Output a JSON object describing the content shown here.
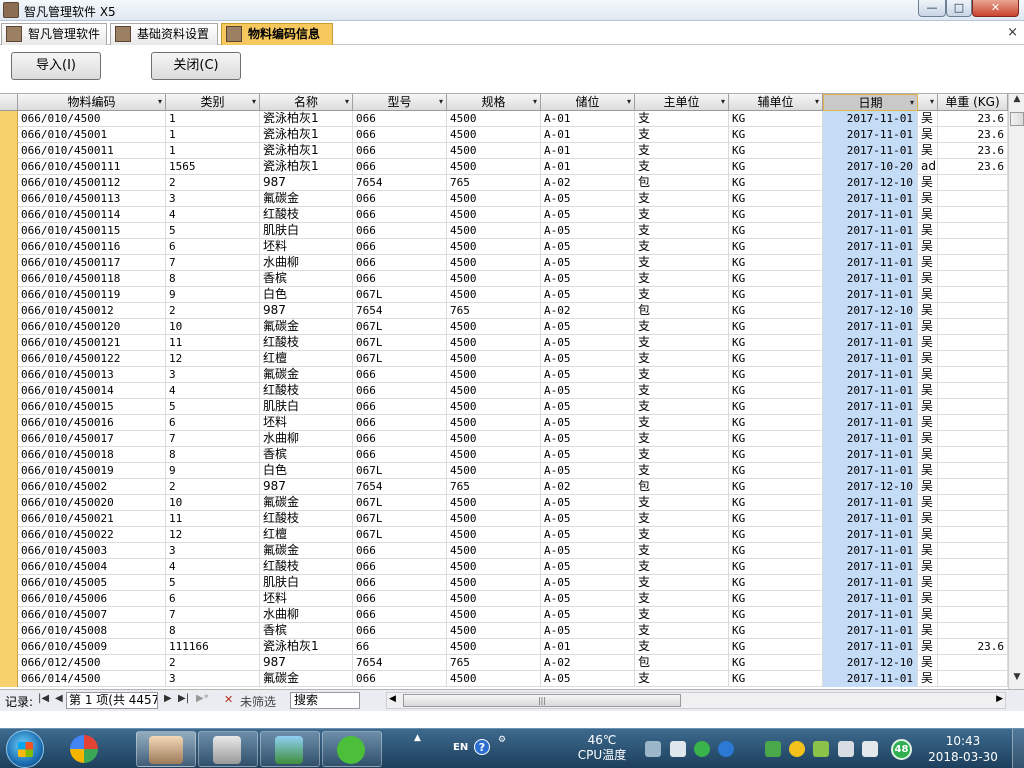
{
  "window": {
    "title": "智凡管理软件 X5",
    "minimize": "—",
    "maximize": "□",
    "close": "✕"
  },
  "tabs": [
    {
      "label": "智凡管理软件",
      "active": false
    },
    {
      "label": "基础资料设置",
      "active": false
    },
    {
      "label": "物料编码信息",
      "active": true
    }
  ],
  "tab_close": "×",
  "toolbar": {
    "import_label": "导入(I)",
    "close_label": "关闭(C)"
  },
  "grid": {
    "columns": [
      {
        "key": "code",
        "label": "物料编码"
      },
      {
        "key": "category",
        "label": "类别"
      },
      {
        "key": "name",
        "label": "名称"
      },
      {
        "key": "model",
        "label": "型号"
      },
      {
        "key": "spec",
        "label": "规格"
      },
      {
        "key": "location",
        "label": "储位"
      },
      {
        "key": "main_unit",
        "label": "主单位"
      },
      {
        "key": "sub_unit",
        "label": "辅单位"
      },
      {
        "key": "date",
        "label": "日期"
      },
      {
        "key": "creator",
        "label": ""
      },
      {
        "key": "unit_weight",
        "label": "单重 (KG)"
      }
    ],
    "rows": [
      [
        "066/010/4500",
        "1",
        "瓷泳柏灰1",
        "066",
        "4500",
        "A-01",
        "支",
        "KG",
        "2017-11-01",
        "吴",
        "23.6"
      ],
      [
        "066/010/45001",
        "1",
        "瓷泳柏灰1",
        "066",
        "4500",
        "A-01",
        "支",
        "KG",
        "2017-11-01",
        "吴",
        "23.6"
      ],
      [
        "066/010/450011",
        "1",
        "瓷泳柏灰1",
        "066",
        "4500",
        "A-01",
        "支",
        "KG",
        "2017-11-01",
        "吴",
        "23.6"
      ],
      [
        "066/010/4500111",
        "1565",
        "瓷泳柏灰1",
        "066",
        "4500",
        "A-01",
        "支",
        "KG",
        "2017-10-20",
        "adm",
        "23.6"
      ],
      [
        "066/010/4500112",
        "2",
        "987",
        "7654",
        "765",
        "A-02",
        "包",
        "KG",
        "2017-12-10",
        "吴",
        ""
      ],
      [
        "066/010/4500113",
        "3",
        "氟碳金",
        "066",
        "4500",
        "A-05",
        "支",
        "KG",
        "2017-11-01",
        "吴",
        ""
      ],
      [
        "066/010/4500114",
        "4",
        "红酸枝",
        "066",
        "4500",
        "A-05",
        "支",
        "KG",
        "2017-11-01",
        "吴",
        ""
      ],
      [
        "066/010/4500115",
        "5",
        "肌肤白",
        "066",
        "4500",
        "A-05",
        "支",
        "KG",
        "2017-11-01",
        "吴",
        ""
      ],
      [
        "066/010/4500116",
        "6",
        "坯料",
        "066",
        "4500",
        "A-05",
        "支",
        "KG",
        "2017-11-01",
        "吴",
        ""
      ],
      [
        "066/010/4500117",
        "7",
        "水曲柳",
        "066",
        "4500",
        "A-05",
        "支",
        "KG",
        "2017-11-01",
        "吴",
        ""
      ],
      [
        "066/010/4500118",
        "8",
        "香槟",
        "066",
        "4500",
        "A-05",
        "支",
        "KG",
        "2017-11-01",
        "吴",
        ""
      ],
      [
        "066/010/4500119",
        "9",
        "白色",
        "067L",
        "4500",
        "A-05",
        "支",
        "KG",
        "2017-11-01",
        "吴",
        ""
      ],
      [
        "066/010/450012",
        "2",
        "987",
        "7654",
        "765",
        "A-02",
        "包",
        "KG",
        "2017-12-10",
        "吴",
        ""
      ],
      [
        "066/010/4500120",
        "10",
        "氟碳金",
        "067L",
        "4500",
        "A-05",
        "支",
        "KG",
        "2017-11-01",
        "吴",
        ""
      ],
      [
        "066/010/4500121",
        "11",
        "红酸枝",
        "067L",
        "4500",
        "A-05",
        "支",
        "KG",
        "2017-11-01",
        "吴",
        ""
      ],
      [
        "066/010/4500122",
        "12",
        "红檀",
        "067L",
        "4500",
        "A-05",
        "支",
        "KG",
        "2017-11-01",
        "吴",
        ""
      ],
      [
        "066/010/450013",
        "3",
        "氟碳金",
        "066",
        "4500",
        "A-05",
        "支",
        "KG",
        "2017-11-01",
        "吴",
        ""
      ],
      [
        "066/010/450014",
        "4",
        "红酸枝",
        "066",
        "4500",
        "A-05",
        "支",
        "KG",
        "2017-11-01",
        "吴",
        ""
      ],
      [
        "066/010/450015",
        "5",
        "肌肤白",
        "066",
        "4500",
        "A-05",
        "支",
        "KG",
        "2017-11-01",
        "吴",
        ""
      ],
      [
        "066/010/450016",
        "6",
        "坯料",
        "066",
        "4500",
        "A-05",
        "支",
        "KG",
        "2017-11-01",
        "吴",
        ""
      ],
      [
        "066/010/450017",
        "7",
        "水曲柳",
        "066",
        "4500",
        "A-05",
        "支",
        "KG",
        "2017-11-01",
        "吴",
        ""
      ],
      [
        "066/010/450018",
        "8",
        "香槟",
        "066",
        "4500",
        "A-05",
        "支",
        "KG",
        "2017-11-01",
        "吴",
        ""
      ],
      [
        "066/010/450019",
        "9",
        "白色",
        "067L",
        "4500",
        "A-05",
        "支",
        "KG",
        "2017-11-01",
        "吴",
        ""
      ],
      [
        "066/010/45002",
        "2",
        "987",
        "7654",
        "765",
        "A-02",
        "包",
        "KG",
        "2017-12-10",
        "吴",
        ""
      ],
      [
        "066/010/450020",
        "10",
        "氟碳金",
        "067L",
        "4500",
        "A-05",
        "支",
        "KG",
        "2017-11-01",
        "吴",
        ""
      ],
      [
        "066/010/450021",
        "11",
        "红酸枝",
        "067L",
        "4500",
        "A-05",
        "支",
        "KG",
        "2017-11-01",
        "吴",
        ""
      ],
      [
        "066/010/450022",
        "12",
        "红檀",
        "067L",
        "4500",
        "A-05",
        "支",
        "KG",
        "2017-11-01",
        "吴",
        ""
      ],
      [
        "066/010/45003",
        "3",
        "氟碳金",
        "066",
        "4500",
        "A-05",
        "支",
        "KG",
        "2017-11-01",
        "吴",
        ""
      ],
      [
        "066/010/45004",
        "4",
        "红酸枝",
        "066",
        "4500",
        "A-05",
        "支",
        "KG",
        "2017-11-01",
        "吴",
        ""
      ],
      [
        "066/010/45005",
        "5",
        "肌肤白",
        "066",
        "4500",
        "A-05",
        "支",
        "KG",
        "2017-11-01",
        "吴",
        ""
      ],
      [
        "066/010/45006",
        "6",
        "坯料",
        "066",
        "4500",
        "A-05",
        "支",
        "KG",
        "2017-11-01",
        "吴",
        ""
      ],
      [
        "066/010/45007",
        "7",
        "水曲柳",
        "066",
        "4500",
        "A-05",
        "支",
        "KG",
        "2017-11-01",
        "吴",
        ""
      ],
      [
        "066/010/45008",
        "8",
        "香槟",
        "066",
        "4500",
        "A-05",
        "支",
        "KG",
        "2017-11-01",
        "吴",
        ""
      ],
      [
        "066/010/45009",
        "111166",
        "瓷泳柏灰1",
        "66",
        "4500",
        "A-01",
        "支",
        "KG",
        "2017-11-01",
        "吴",
        "23.6"
      ],
      [
        "066/012/4500",
        "2",
        "987",
        "7654",
        "765",
        "A-02",
        "包",
        "KG",
        "2017-12-10",
        "吴",
        ""
      ],
      [
        "066/014/4500",
        "3",
        "氟碳金",
        "066",
        "4500",
        "A-05",
        "支",
        "KG",
        "2017-11-01",
        "吴",
        ""
      ]
    ]
  },
  "navbar": {
    "record_label": "记录:",
    "record_value": "第 1 项(共 4457",
    "filter_label": "未筛选",
    "search_label": "搜索"
  },
  "taskbar": {
    "language": "EN",
    "temp_value": "46℃",
    "temp_label": "CPU温度",
    "badge": "48",
    "time": "10:43",
    "date": "2018-03-30"
  },
  "colors": {
    "selector": "#f7d16c",
    "date_column": "#c5dcf7",
    "active_tab": "#f7c85e"
  }
}
